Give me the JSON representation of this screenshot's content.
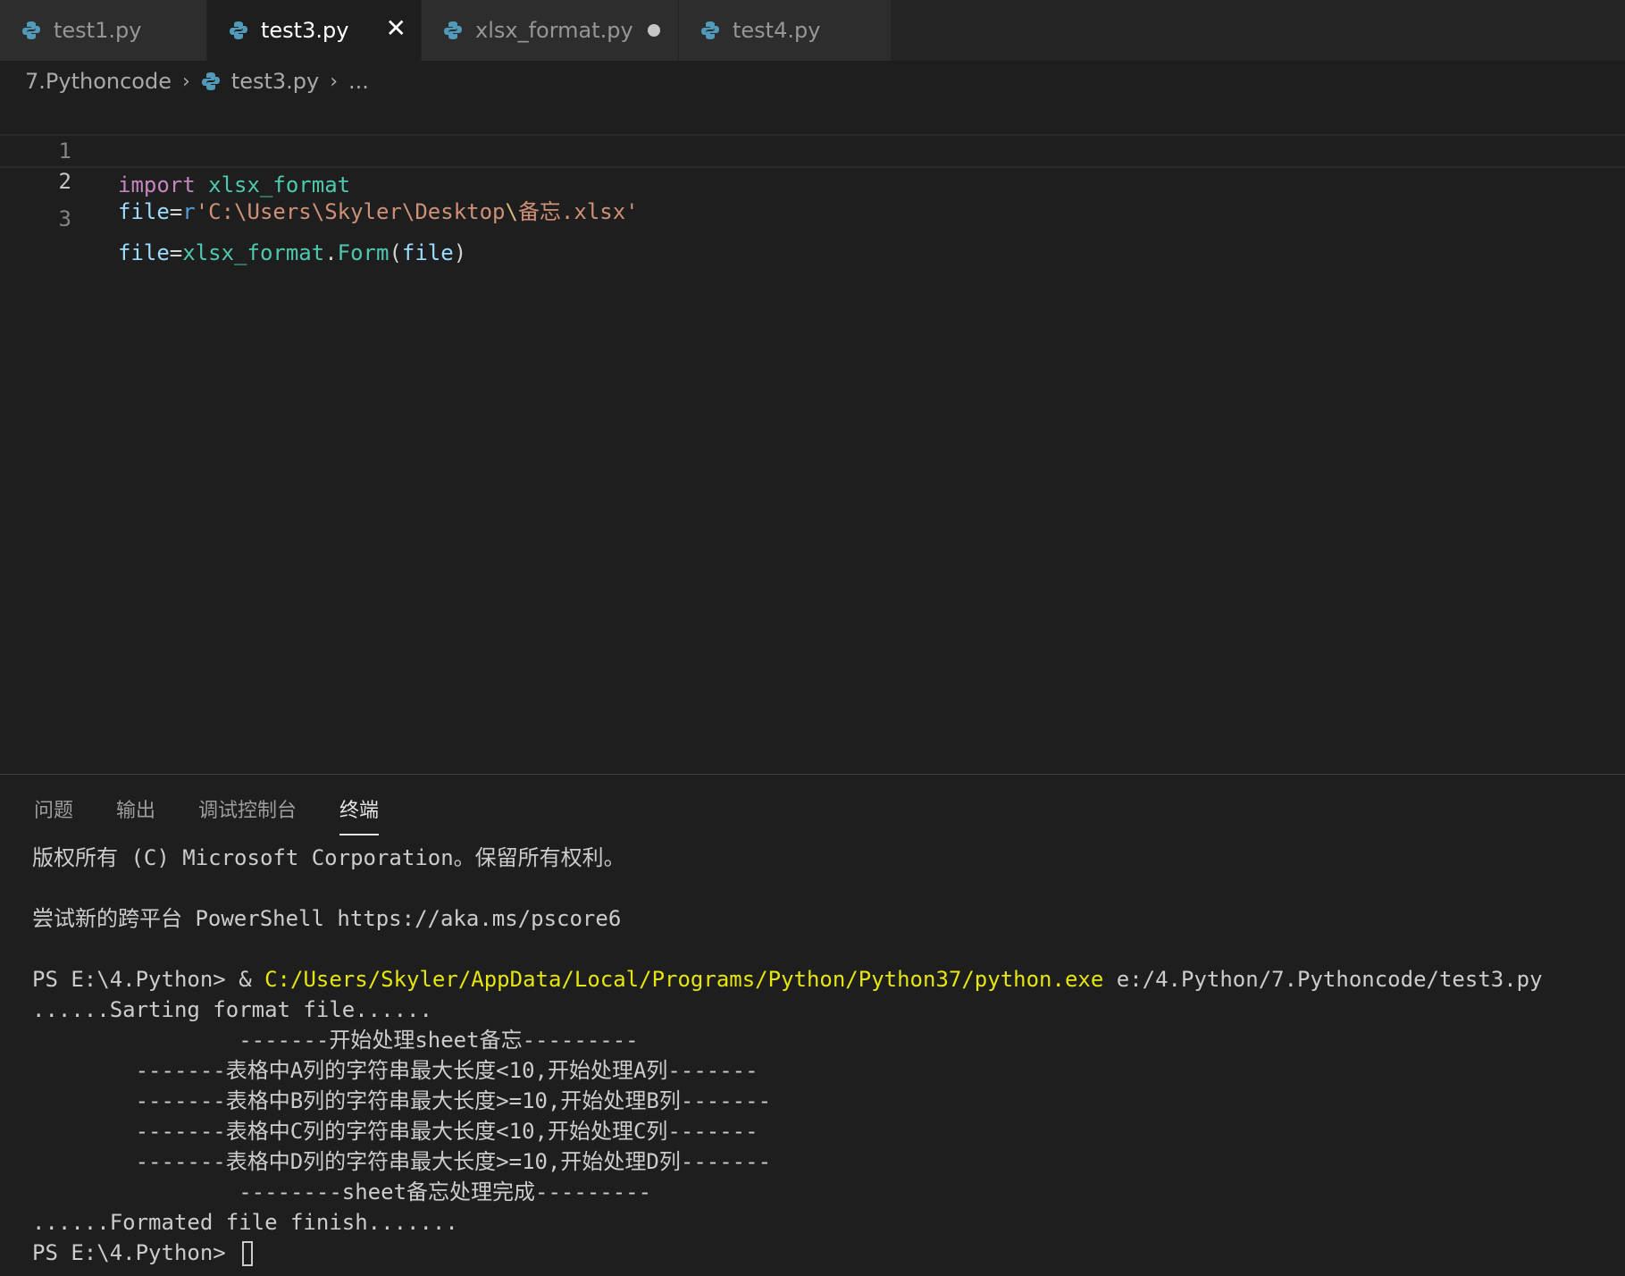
{
  "tabs": [
    {
      "label": "test1.py",
      "active": false,
      "dirty": false
    },
    {
      "label": "test3.py",
      "active": true,
      "dirty": false
    },
    {
      "label": "xlsx_format.py",
      "active": false,
      "dirty": true
    },
    {
      "label": "test4.py",
      "active": false,
      "dirty": false
    }
  ],
  "breadcrumb": {
    "folder": "7.Pythoncode",
    "file": "test3.py",
    "more": "..."
  },
  "editor": {
    "lines": [
      {
        "number": "1",
        "tokens": [
          "import",
          " ",
          "xlsx_format"
        ]
      },
      {
        "number": "2",
        "tokens": [
          "file",
          "=",
          "r",
          "'C:\\Users\\Skyler\\Desktop",
          "\\",
          "备忘.xlsx'"
        ]
      },
      {
        "number": "3",
        "tokens": [
          "file",
          "=",
          "xlsx_format",
          ".",
          "Form",
          "(",
          "file",
          ")"
        ]
      }
    ]
  },
  "panel": {
    "tabs": [
      "问题",
      "输出",
      "调试控制台",
      "终端"
    ],
    "active_tab": "终端"
  },
  "terminal": {
    "lines": [
      "版权所有 (C) Microsoft Corporation。保留所有权利。",
      "",
      "尝试新的跨平台 PowerShell https://aka.ms/pscore6",
      "",
      "",
      "......Sarting format file......",
      "                -------开始处理sheet备忘---------",
      "        -------表格中A列的字符串最大长度<10,开始处理A列-------",
      "        -------表格中B列的字符串最大长度>=10,开始处理B列-------",
      "        -------表格中C列的字符串最大长度<10,开始处理C列-------",
      "        -------表格中D列的字符串最大长度>=10,开始处理D列-------",
      "                --------sheet备忘处理完成---------",
      "......Formated file finish.......",
      ""
    ],
    "command_prompt": "PS E:\\4.Python> ",
    "command_amp": "& ",
    "command_exe": "C:/Users/Skyler/AppData/Local/Programs/Python/Python37/python.exe",
    "command_arg": " e:/4.Python/7.Pythoncode/test3.py",
    "final_prompt": "PS E:\\4.Python> "
  },
  "colors": {
    "editor_bg": "#1e1e1e",
    "tabbar_bg": "#252526",
    "exe_path": "#e5e510"
  }
}
